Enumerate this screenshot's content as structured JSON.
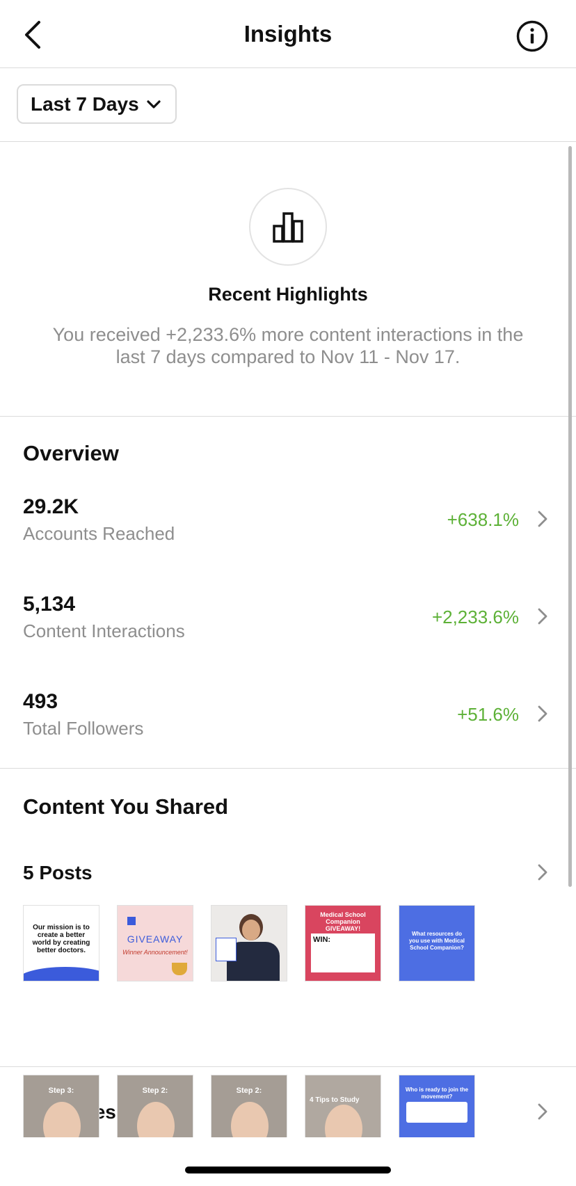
{
  "header": {
    "title": "Insights",
    "back_icon": "chevron-left-icon",
    "info_icon": "info-icon"
  },
  "filter": {
    "label": "Last 7 Days"
  },
  "highlights": {
    "title": "Recent Highlights",
    "text": "You received +2,233.6% more content interactions in the last 7 days compared to Nov 11 - Nov 17."
  },
  "overview": {
    "title": "Overview",
    "metrics": [
      {
        "value": "29.2K",
        "label": "Accounts Reached",
        "change": "+638.1%"
      },
      {
        "value": "5,134",
        "label": "Content Interactions",
        "change": "+2,233.6%"
      },
      {
        "value": "493",
        "label": "Total Followers",
        "change": "+51.6%"
      }
    ]
  },
  "content": {
    "title": "Content You Shared",
    "posts_label": "5 Posts",
    "stories_label": "27 Stories",
    "posts": [
      {
        "text": "Our mission is to create a better world by creating better doctors."
      },
      {
        "text": "GIVEAWAY",
        "subtext": "Winner Announcement!"
      },
      {
        "text": ""
      },
      {
        "text": "Medical School Companion GIVEAWAY!",
        "subtext": "WIN:"
      },
      {
        "text": "What resources do you use with Medical School Companion?"
      }
    ],
    "stories": [
      {
        "text": "Step 3:"
      },
      {
        "text": "Step 2:"
      },
      {
        "text": "Step 2:"
      },
      {
        "text": "4 Tips to Study"
      },
      {
        "text": "Who is ready to join the movement?"
      }
    ]
  },
  "colors": {
    "positive": "#5db137",
    "muted": "#8e8e8e",
    "divider": "#dbdbdb"
  }
}
